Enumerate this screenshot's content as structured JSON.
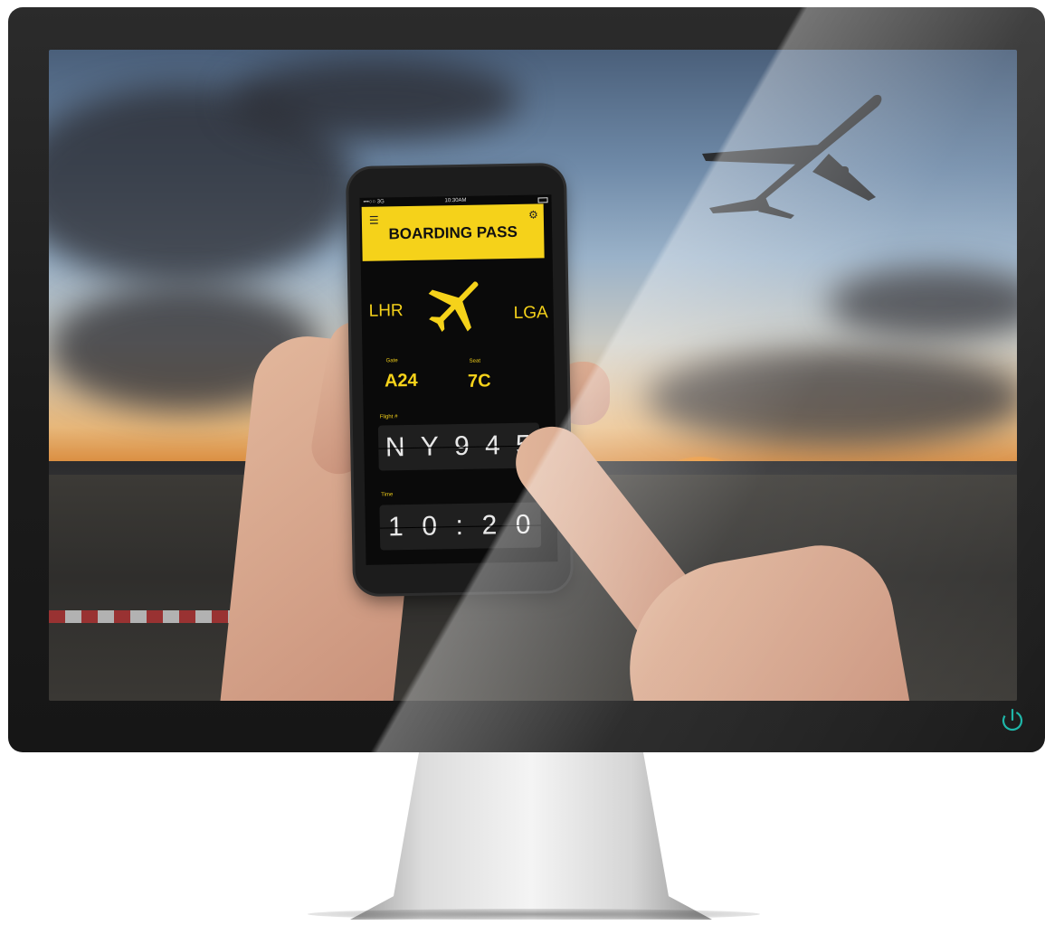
{
  "phone_app": {
    "status_bar": {
      "carrier": "•••○○ 3G",
      "time": "10:30AM"
    },
    "header": {
      "title": "BOARDING PASS",
      "menu_icon": "menu-icon",
      "settings_icon": "gear-icon"
    },
    "route": {
      "origin": "LHR",
      "destination": "LGA",
      "icon": "airplane-icon"
    },
    "gate": {
      "label": "Gate",
      "value": "A24"
    },
    "seat": {
      "label": "Seat",
      "value": "7C"
    },
    "flight": {
      "label": "Flight #",
      "chars": [
        "N",
        "Y",
        "9",
        "4",
        "5"
      ]
    },
    "time": {
      "label": "Time",
      "chars": [
        "1",
        "0",
        ":",
        "2",
        "0"
      ]
    }
  },
  "monitor": {
    "power_icon": "power-icon",
    "accent": "#1fb6a8"
  },
  "colors": {
    "boarding_yellow": "#f5d21a",
    "app_background": "#0a0a0a"
  }
}
